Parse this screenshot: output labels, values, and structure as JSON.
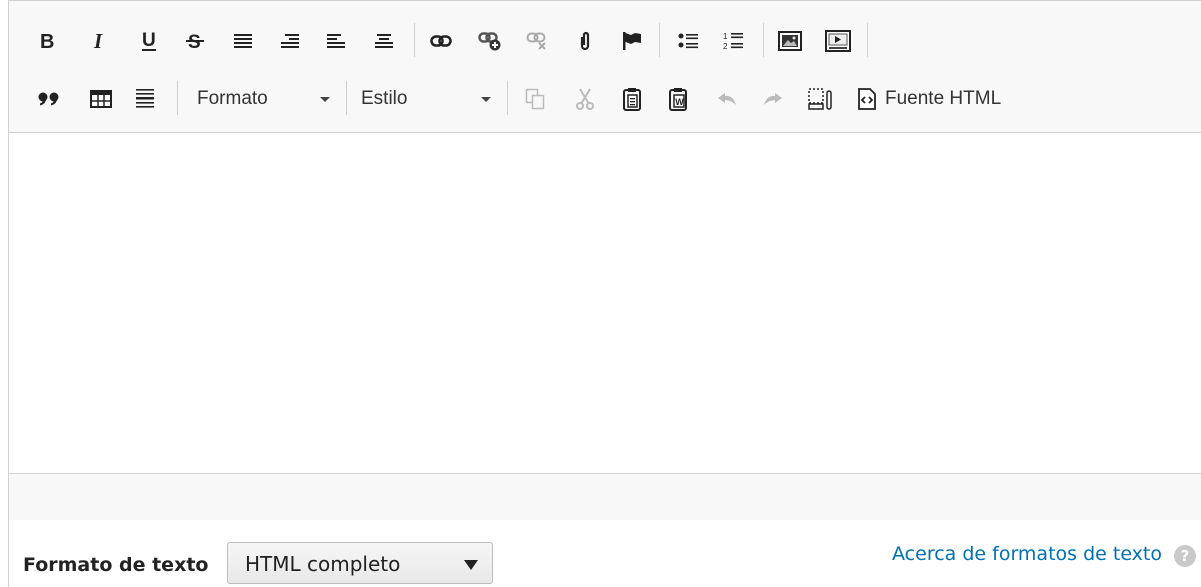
{
  "toolbar": {
    "row1_icons": [
      "bold-icon",
      "italic-icon",
      "underline-icon",
      "strikethrough-icon",
      "align-justify-icon",
      "align-right-icon",
      "align-left-icon",
      "align-center-icon",
      "link-icon",
      "add-link-icon",
      "unlink-icon",
      "paperclip-icon",
      "anchor-flag-icon",
      "bulleted-list-icon",
      "numbered-list-icon",
      "image-icon",
      "video-icon"
    ],
    "row2_icons": [
      "blockquote-icon",
      "table-icon",
      "horizontal-rule-icon",
      "copy-icon",
      "cut-icon",
      "paste-icon",
      "paste-from-word-icon",
      "undo-icon",
      "redo-icon",
      "show-blocks-icon",
      "source-icon"
    ],
    "format_combo": "Formato",
    "style_combo": "Estilo",
    "source_label": "Fuente HTML"
  },
  "footer": {
    "format_label": "Formato de texto",
    "format_selected": "HTML completo",
    "help_link": "Acerca de formatos de texto",
    "help_glyph": "?"
  }
}
